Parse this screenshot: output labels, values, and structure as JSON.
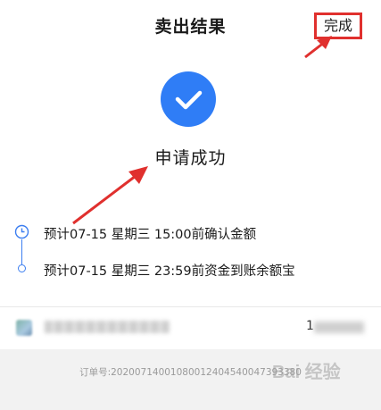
{
  "header": {
    "title": "卖出结果",
    "done_label": "完成"
  },
  "status": {
    "icon": "check-icon",
    "text": "申请成功"
  },
  "timeline": [
    {
      "icon": "clock-icon",
      "text": "预计07-15 星期三 15:00前确认金额"
    },
    {
      "icon": "dot-icon",
      "text": "预计07-15 星期三 23:59前资金到账余额宝"
    }
  ],
  "asset": {
    "amount_visible_prefix": "1"
  },
  "footer": {
    "order_no": "订单号:20200714001080012404540047393380"
  },
  "watermark": {
    "text": "Bai 经验"
  },
  "colors": {
    "accent": "#2f7df6",
    "annotation": "#e0302e",
    "footer_bg": "#f2f2f2"
  }
}
